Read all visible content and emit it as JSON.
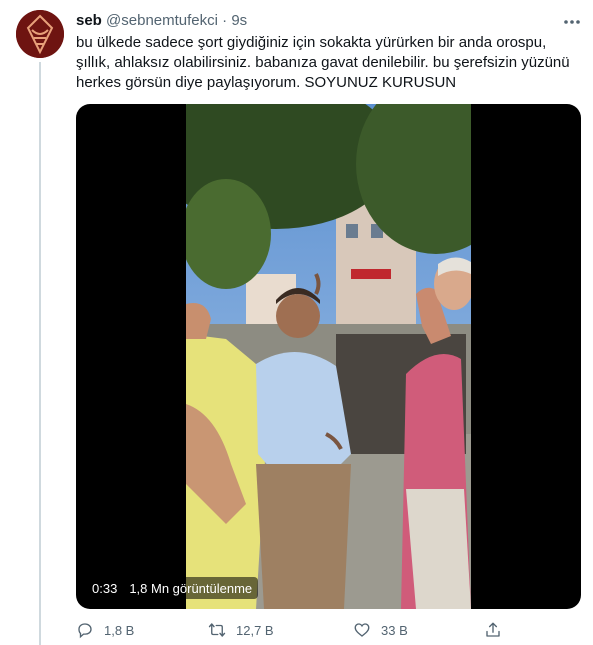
{
  "tweet": {
    "author_name": "seb",
    "handle": "@sebnemtufekci",
    "separator": "·",
    "time": "9s",
    "text": "bu ülkede sadece şort giydiğiniz için sokakta yürürken bir anda orospu, şıllık, ahlaksız olabilirsiniz. babanıza gavat denilebilir. bu şerefsizin yüzünü herkes görsün diye paylaşıyorum. SOYUNUZ KURUSUN",
    "media": {
      "duration": "0:33",
      "views": "1,8 Mn görüntülenme"
    },
    "actions": {
      "replies": "1,8 B",
      "retweets": "12,7 B",
      "likes": "33 B"
    }
  },
  "colors": {
    "text": "#0f1419",
    "secondary": "#536471",
    "thread_line": "#cfd9de",
    "video_background": "#000000"
  },
  "icons": {
    "more": "more-icon",
    "reply": "reply-icon",
    "retweet": "retweet-icon",
    "like": "heart-icon",
    "share": "share-icon"
  }
}
